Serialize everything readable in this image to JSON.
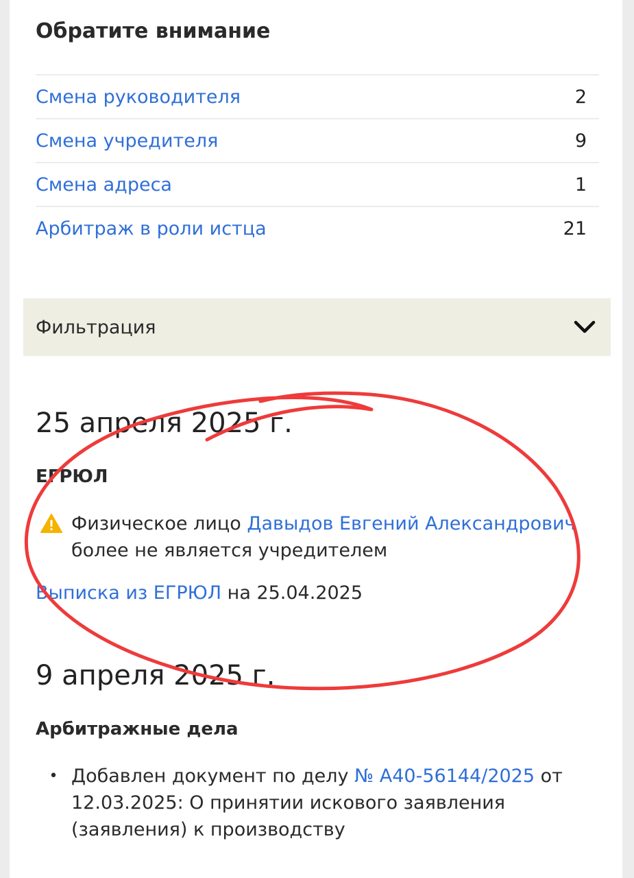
{
  "attention": {
    "title": "Обратите внимание",
    "items": [
      {
        "label": "Смена руководителя",
        "count": "2"
      },
      {
        "label": "Смена учредителя",
        "count": "9"
      },
      {
        "label": "Смена адреса",
        "count": "1"
      },
      {
        "label": "Арбитраж в роли истца",
        "count": "21"
      }
    ]
  },
  "filter": {
    "label": "Фильтрация",
    "icon": "chevron-down-icon"
  },
  "events": [
    {
      "date": "25 апреля 2025 г.",
      "section": "ЕГРЮЛ",
      "entry": {
        "icon": "warning-icon",
        "prefix": "Физическое лицо ",
        "person_link": "Давыдов Евгений Александрович",
        "suffix": "более не является учредителем"
      },
      "extract": {
        "link": "Выписка из ЕГРЮЛ",
        "suffix": " на 25.04.2025"
      }
    },
    {
      "date": "9 апреля 2025 г.",
      "section": "Арбитражные дела",
      "entry": {
        "prefix": "Добавлен документ по делу ",
        "case_link": "№ А40-56144/2025",
        "suffix": " от 12.03.2025: О принятии искового заявления (заявления) к производству"
      }
    }
  ],
  "colors": {
    "link": "#2f6fd8",
    "filter_bg": "#eeeee3",
    "warning": "#f5b300",
    "annotation": "#ee3b3b"
  }
}
